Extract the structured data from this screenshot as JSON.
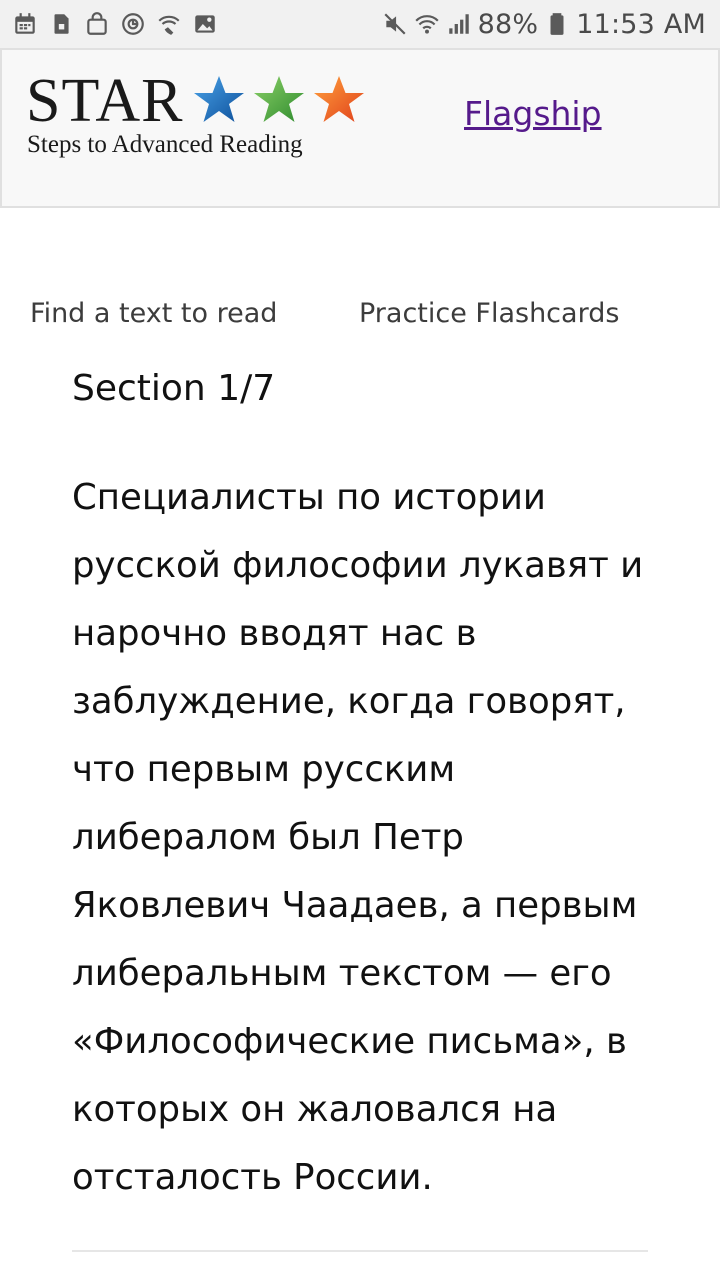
{
  "status_bar": {
    "left_icons": [
      "calendar-icon",
      "sim-card-icon",
      "shopping-bag-icon",
      "sync-icon",
      "wifi-calling-icon",
      "gallery-icon"
    ],
    "right_icons": [
      "mute-icon",
      "wifi-icon",
      "signal-icon",
      "battery-icon"
    ],
    "battery": "88%",
    "time": "11:53 AM"
  },
  "header": {
    "logo_word": "STAR",
    "logo_tagline": "Steps to Advanced Reading",
    "logo_star_colors": [
      "#1e73be",
      "#4caf50",
      "#f26522"
    ],
    "flagship_link": "Flagship"
  },
  "nav": {
    "find_text": "Find a text to read",
    "practice_flashcards": "Practice Flashcards"
  },
  "section": {
    "heading": "Section 1/7",
    "lines": [
      "Специалисты по истории",
      "русской философии лукавят и",
      "нарочно вводят нас в",
      "заблуждение, когда говорят,",
      "что первым русским",
      "либералом был Петр",
      "Яковлевич Чаадаев, а первым",
      "либеральным текстом — его",
      "«Философические письма», в",
      "которых он жаловался на",
      "отсталость России."
    ]
  },
  "colors": {
    "status_bar_bg": "#f1f1f1",
    "header_bg": "#f8f8f8",
    "link_visited": "#551a8b"
  }
}
